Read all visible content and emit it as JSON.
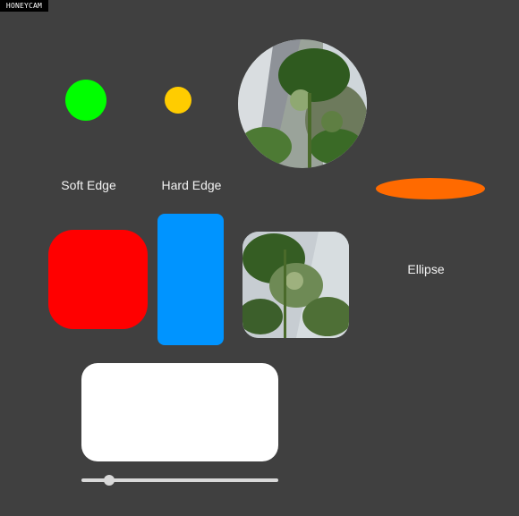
{
  "watermark": {
    "text": "HONEYCAM"
  },
  "labels": {
    "soft_edge": "Soft Edge",
    "hard_edge": "Hard Edge",
    "ellipse": "Ellipse"
  },
  "colors": {
    "background": "#404040",
    "green": "#00ff00",
    "yellow": "#ffcc00",
    "orange": "#ff6a00",
    "red": "#ff0000",
    "blue": "#0094ff",
    "white": "#ffffff"
  },
  "images": {
    "photo_circle": "tomato-plant-photo",
    "photo_rounded": "tomato-plant-photo"
  },
  "slider": {
    "value_fraction": 0.12
  }
}
